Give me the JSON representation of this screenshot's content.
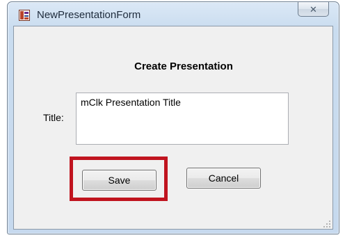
{
  "window": {
    "title": "NewPresentationForm",
    "close_glyph": "✕"
  },
  "form": {
    "heading": "Create Presentation",
    "title_label": "Title:",
    "title_value": "mClk Presentation Title",
    "save_label": "Save",
    "cancel_label": "Cancel"
  },
  "icons": {
    "app": "app-icon",
    "close": "close-icon",
    "resize": "resize-grip-icon"
  },
  "colors": {
    "highlight": "#c0141f",
    "client_bg": "#f0f0f0"
  }
}
